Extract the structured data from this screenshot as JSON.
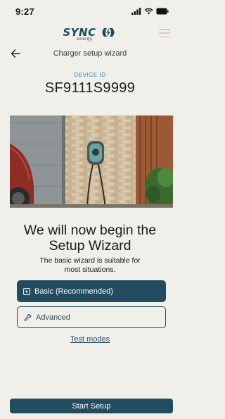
{
  "status_bar": {
    "time": "9:27"
  },
  "brand": {
    "logo_text": "SYNC",
    "logo_subtext": "energy"
  },
  "nav": {
    "title": "Charger setup wizard"
  },
  "device": {
    "label": "DEVICE ID",
    "id": "SF9111S9999"
  },
  "hero_image": {
    "icon_name": "wall-charger-photo"
  },
  "content": {
    "heading": "We will now begin the Setup Wizard",
    "description": "The basic wizard is suitable for most situations."
  },
  "options": {
    "basic": {
      "label": "Basic (Recommended)",
      "icon": "play-square-icon",
      "selected": true
    },
    "advanced": {
      "label": "Advanced",
      "icon": "wrench-icon",
      "selected": false
    }
  },
  "links": {
    "test_modes": "Test modes"
  },
  "actions": {
    "start_setup": "Start Setup"
  },
  "colors": {
    "background": "#f1efea",
    "primary": "#234c60",
    "accent": "#3a84b8"
  }
}
